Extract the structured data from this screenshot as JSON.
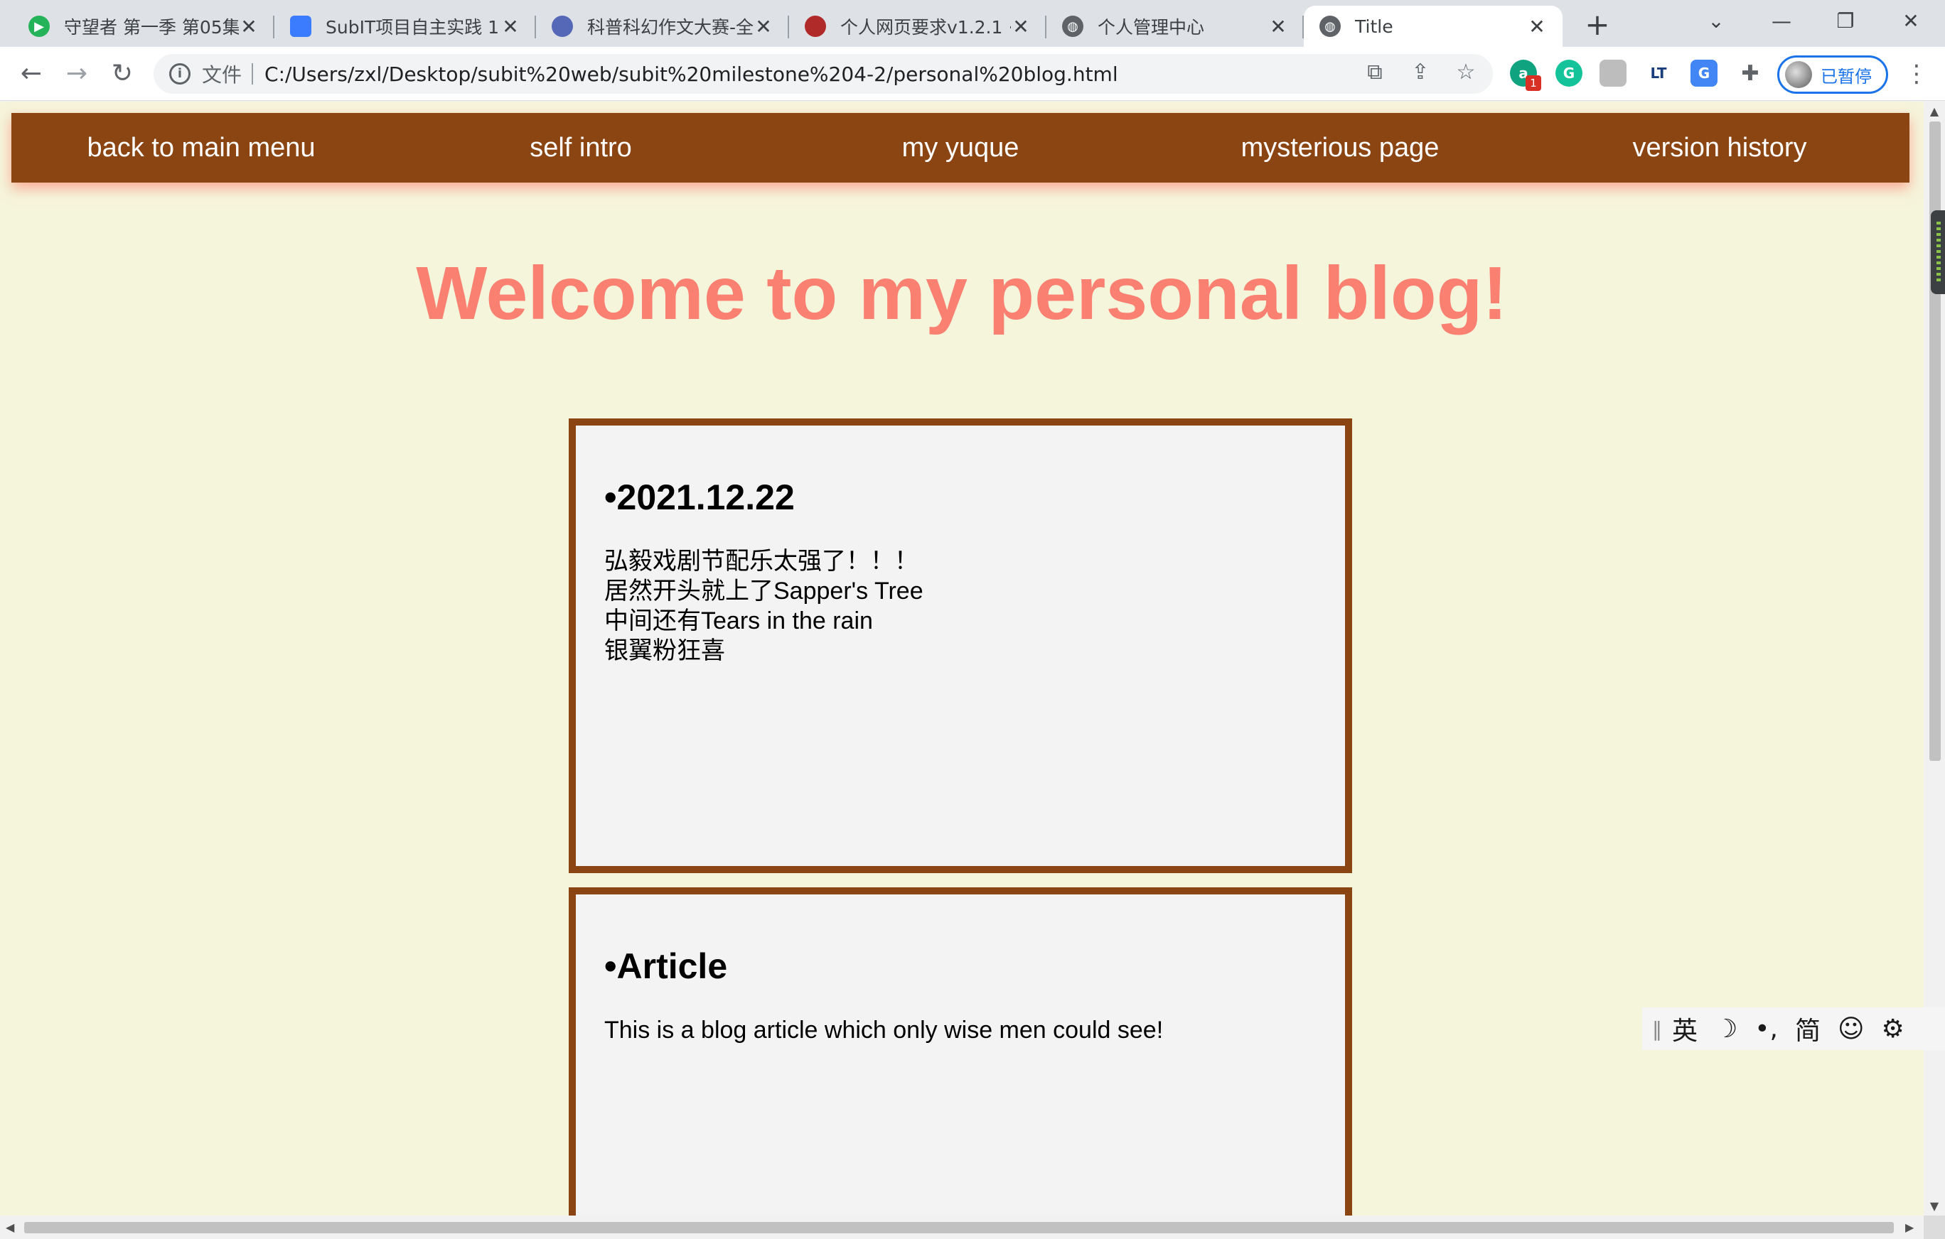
{
  "browser": {
    "tabs": [
      {
        "title": "守望者 第一季 第05集",
        "icon": "play-icon",
        "color": "#25b35a",
        "active": false
      },
      {
        "title": "SubIT项目自主实践 1.",
        "icon": "doc-icon",
        "color": "#3b7cff",
        "active": false
      },
      {
        "title": "科普科幻作文大赛-全",
        "icon": "site-icon",
        "color": "#5568b8",
        "active": false
      },
      {
        "title": "个人网页要求v1.2.1 · ",
        "icon": "site-icon",
        "color": "#b02a2a",
        "active": false
      },
      {
        "title": "个人管理中心",
        "icon": "globe-icon",
        "color": "#5f6368",
        "active": false
      },
      {
        "title": "Title",
        "icon": "globe-icon",
        "color": "#5f6368",
        "active": true
      }
    ],
    "new_tab_label": "+",
    "address": {
      "scheme_label": "文件",
      "url": "C:/Users/zxl/Desktop/subit%20web/subit%20milestone%204-2/personal%20blog.html"
    },
    "extensions": {
      "badge": "1",
      "lt_label": "LT",
      "g_label": "G",
      "a_label": "a"
    },
    "profile_label": "已暂停"
  },
  "site": {
    "nav": [
      {
        "label": "back to main menu"
      },
      {
        "label": "self intro"
      },
      {
        "label": "my yuque"
      },
      {
        "label": "mysterious page"
      },
      {
        "label": "version history"
      }
    ],
    "headline": "Welcome to my personal blog!",
    "posts": [
      {
        "title": "•2021.12.22",
        "lines": [
          "弘毅戏剧节配乐太强了！！！",
          "居然开头就上了Sapper's Tree",
          "中间还有Tears in the rain",
          "银翼粉狂喜"
        ]
      },
      {
        "title": "•Article",
        "lines": [
          "This is a blog article which only wise men could see!"
        ]
      }
    ],
    "colors": {
      "background": "#f5f5dc",
      "nav": "#8b4513",
      "headline": "#fa8072",
      "card": "#f3f3f3",
      "card_border": "#8b4513"
    }
  },
  "ime": {
    "mode": "英",
    "moon": "☽",
    "punct": "•,",
    "charset": "简",
    "emoji": "☺",
    "settings": "⚙"
  }
}
